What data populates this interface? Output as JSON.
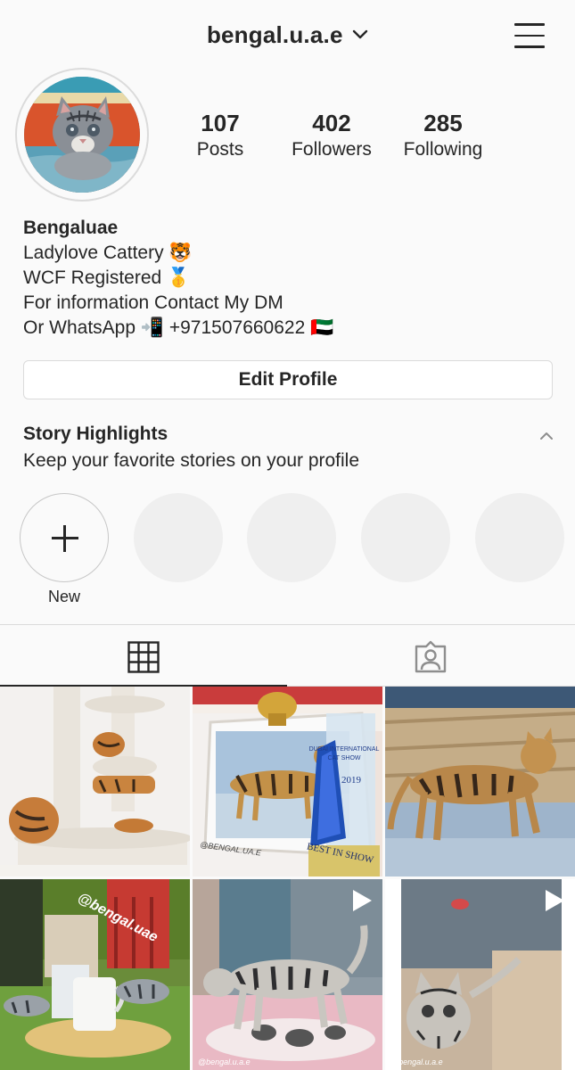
{
  "header": {
    "username": "bengal.u.a.e"
  },
  "stats": [
    {
      "value": "107",
      "label": "Posts"
    },
    {
      "value": "402",
      "label": "Followers"
    },
    {
      "value": "285",
      "label": "Following"
    }
  ],
  "bio": {
    "name": "Bengaluae",
    "lines": [
      "Ladylove Cattery 🐯",
      "WCF Registered 🥇",
      "For information Contact My DM",
      "Or WhatsApp 📲 +971507660622 🇦🇪"
    ]
  },
  "profile": {
    "edit_label": "Edit Profile"
  },
  "highlights": {
    "title": "Story Highlights",
    "subtitle": "Keep your favorite stories on your profile",
    "new_label": "New"
  },
  "posts": [
    {
      "overlay_text": ""
    },
    {
      "overlay_text": "@BENGAL.UA.E",
      "trophy_lines": [
        "DUBAI INTERNATIONAL",
        "CAT SHOW",
        "2019",
        "BEST IN SHOW"
      ]
    },
    {
      "overlay_text": ""
    },
    {
      "overlay_text": "@bengal.uae"
    },
    {
      "overlay_text": "@bengal.u.a.e"
    },
    {
      "overlay_text": "@bengal.u.a.e"
    }
  ],
  "colors": {
    "text": "#262626",
    "border": "#dbdbdb",
    "placeholder": "#efefef",
    "background": "#fafafa"
  },
  "icons": {
    "menu": "hamburger-icon",
    "grid": "grid-icon",
    "tagged": "tagged-photos-icon",
    "video": "play-icon"
  }
}
